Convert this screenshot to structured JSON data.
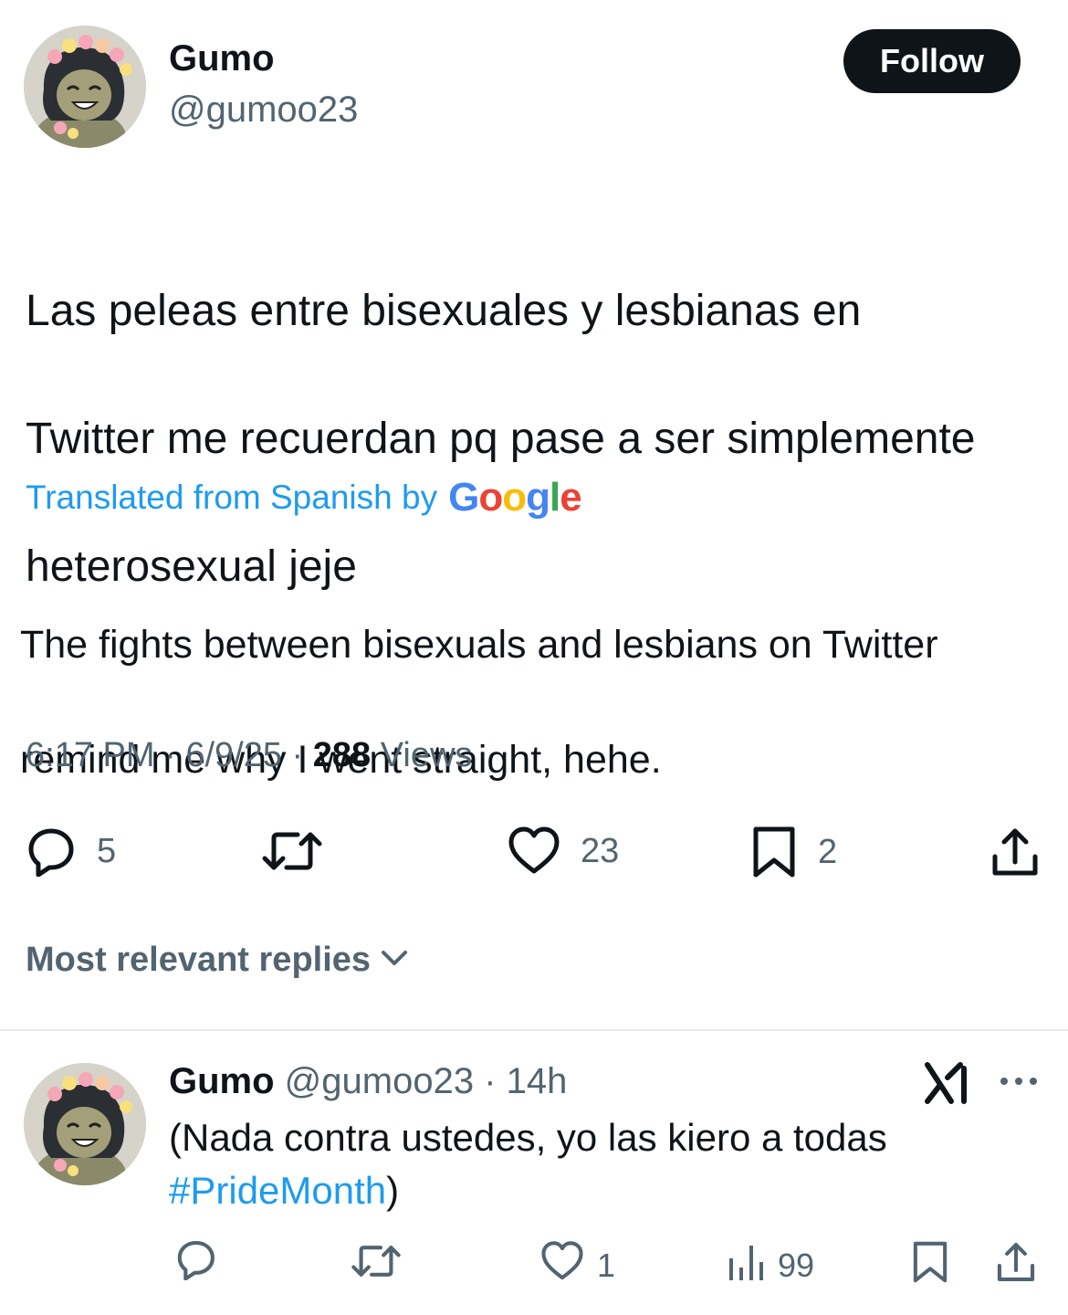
{
  "tweet": {
    "author_name": "Gumo",
    "author_handle": "@gumoo23",
    "follow_label": "Follow",
    "text_lines": [
      "Las peleas entre bisexuales y lesbianas en",
      "Twitter me recuerdan pq pase a ser simplemente",
      "heterosexual jeje"
    ],
    "translated_label": "Translated from Spanish by",
    "translator_logo": "Google",
    "translation_lines": [
      "The fights between bisexuals and lesbians on Twitter",
      "remind me why I went straight, hehe."
    ],
    "time": "6:17 PM",
    "date": "6/9/25",
    "separator": "·",
    "views_count": "288",
    "views_label": "Views",
    "actions": {
      "replies": "5",
      "likes": "23",
      "bookmarks": "2"
    }
  },
  "replies_section": {
    "sort_label": "Most relevant replies"
  },
  "reply": {
    "author_name": "Gumo",
    "author_handle": "@gumoo23",
    "time": "14h",
    "text_main": "(Nada contra ustedes, yo las kiero a todas",
    "hashtag": "#PrideMonth",
    "text_end": ")",
    "actions": {
      "likes": "1",
      "views": "99"
    }
  },
  "icons": {
    "reply": "reply-icon",
    "retweet": "retweet-icon",
    "like": "heart-icon",
    "bookmark": "bookmark-icon",
    "share": "share-icon",
    "views": "views-icon",
    "more": "more-icon",
    "grok": "grok-icon",
    "chevron": "chevron-down-icon"
  },
  "colors": {
    "text": "#0f1419",
    "secondary": "#536471",
    "accent": "#1d9bf0",
    "button_bg": "#0f1419"
  }
}
